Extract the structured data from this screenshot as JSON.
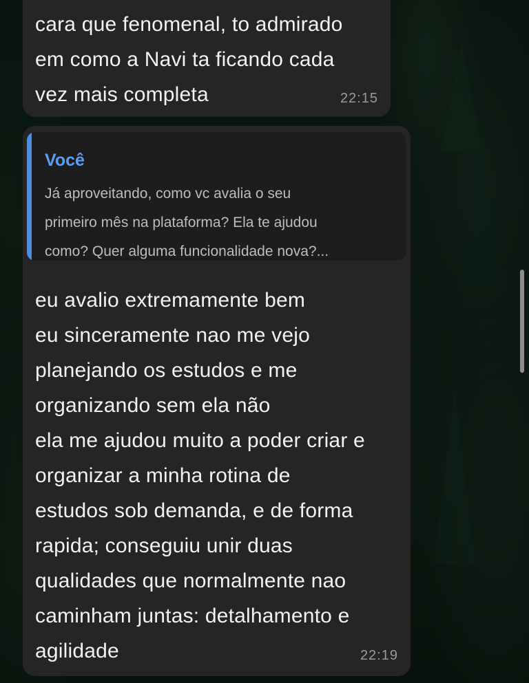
{
  "chat": {
    "messages": [
      {
        "sender": "",
        "text": "cara que fenomenal, to admirado\nem como a Navi ta ficando cada\nvez mais completa",
        "time": "22:15"
      },
      {
        "sender": "",
        "reply_to": {
          "author": "Você",
          "text": "Já aproveitando, como vc avalia o seu\nprimeiro mês na plataforma? Ela te ajudou\ncomo? Quer alguma funcionalidade nova?..."
        },
        "text": "eu avalio extremamente bem\neu sinceramente nao me vejo\nplanejando os estudos e me\norganizando sem ela não\nela me ajudou muito a poder criar e\norganizar a minha rotina de\nestudos sob demanda, e de forma\nrapida; conseguiu unir duas\nqualidades que normalmente nao\ncaminham juntas: detalhamento e\nagilidade",
        "time": "22:19"
      }
    ]
  },
  "colors": {
    "bubble": "#252525",
    "quote_bar": "#4a8fe7",
    "quote_author": "#5aa0f2",
    "timestamp": "#9a9a9a",
    "background": "#0a160f"
  }
}
